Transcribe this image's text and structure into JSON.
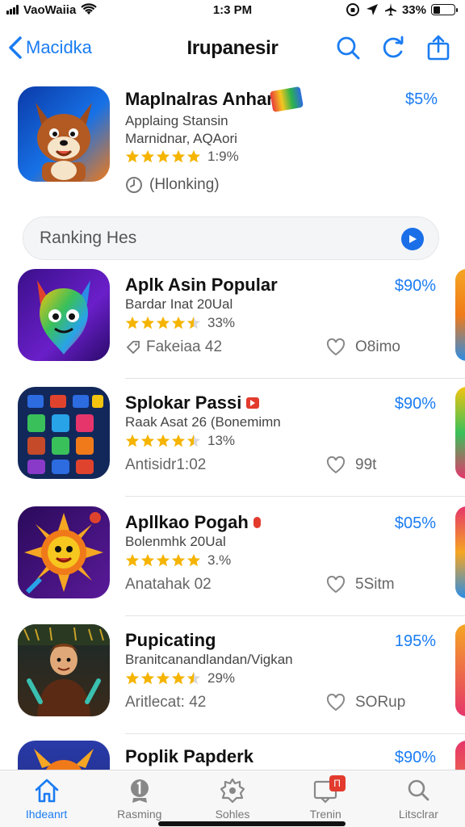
{
  "status_bar": {
    "carrier": "VaoWaiia",
    "time": "1:3 PM",
    "battery": "33%",
    "battery_level": 0.33
  },
  "nav": {
    "back_label": "Macidka",
    "title": "Irupanesir"
  },
  "featured": {
    "title": "Maplnalras Anhara",
    "price": "$5%",
    "subtitle": "Applaing Stansin",
    "developer": "Marnidnar, AQAori",
    "rating_text": "1:9%",
    "stars": 5,
    "status_text": "(Hlonking)"
  },
  "section": {
    "label": "Ranking Hes"
  },
  "apps": [
    {
      "name": "Aplk Asin Popular",
      "price": "$90%",
      "subtitle": "Bardar Inat 20Ual",
      "rating_text": "33%",
      "stars": 4.5,
      "meta": "Fakeiaa 42",
      "downloads": "O8imo",
      "icon": "rainbow-monster-icon"
    },
    {
      "name": "Splokar Passi",
      "price": "$90%",
      "subtitle": "Raak Asat 26 (Bonemimn",
      "rating_text": "13%",
      "stars": 4.5,
      "meta": "Antisidr1:02",
      "downloads": "99t",
      "icon": "app-grid-icon"
    },
    {
      "name": "Apllkao Pogah",
      "price": "$05%",
      "subtitle": "Bolenmhk 20Ual",
      "rating_text": "3.%",
      "stars": 5,
      "meta": "Anatahak 02",
      "downloads": "5Sitm",
      "icon": "sun-face-icon"
    },
    {
      "name": "Pupicating",
      "price": "195%",
      "subtitle": "Branitcanandlandan/Vigkan",
      "rating_text": "29%",
      "stars": 4.5,
      "meta": "Aritlecat: 42",
      "downloads": "SORup",
      "icon": "character-portrait-icon"
    },
    {
      "name": "Poplik Papderk",
      "price": "$90%",
      "icon": "phoenix-icon"
    }
  ],
  "tabs": [
    {
      "label": "Ihdeanrt",
      "icon": "home-icon",
      "active": true
    },
    {
      "label": "Rasming",
      "icon": "ranking-icon",
      "active": false
    },
    {
      "label": "Sohles",
      "icon": "games-icon",
      "active": false
    },
    {
      "label": "Trenin",
      "icon": "updates-icon",
      "badge": "Π",
      "active": false
    },
    {
      "label": "Litsclrar",
      "icon": "search-icon",
      "active": false
    }
  ],
  "colors": {
    "accent": "#1a7cf2",
    "star": "#f5b400",
    "badge": "#e23b2e"
  }
}
